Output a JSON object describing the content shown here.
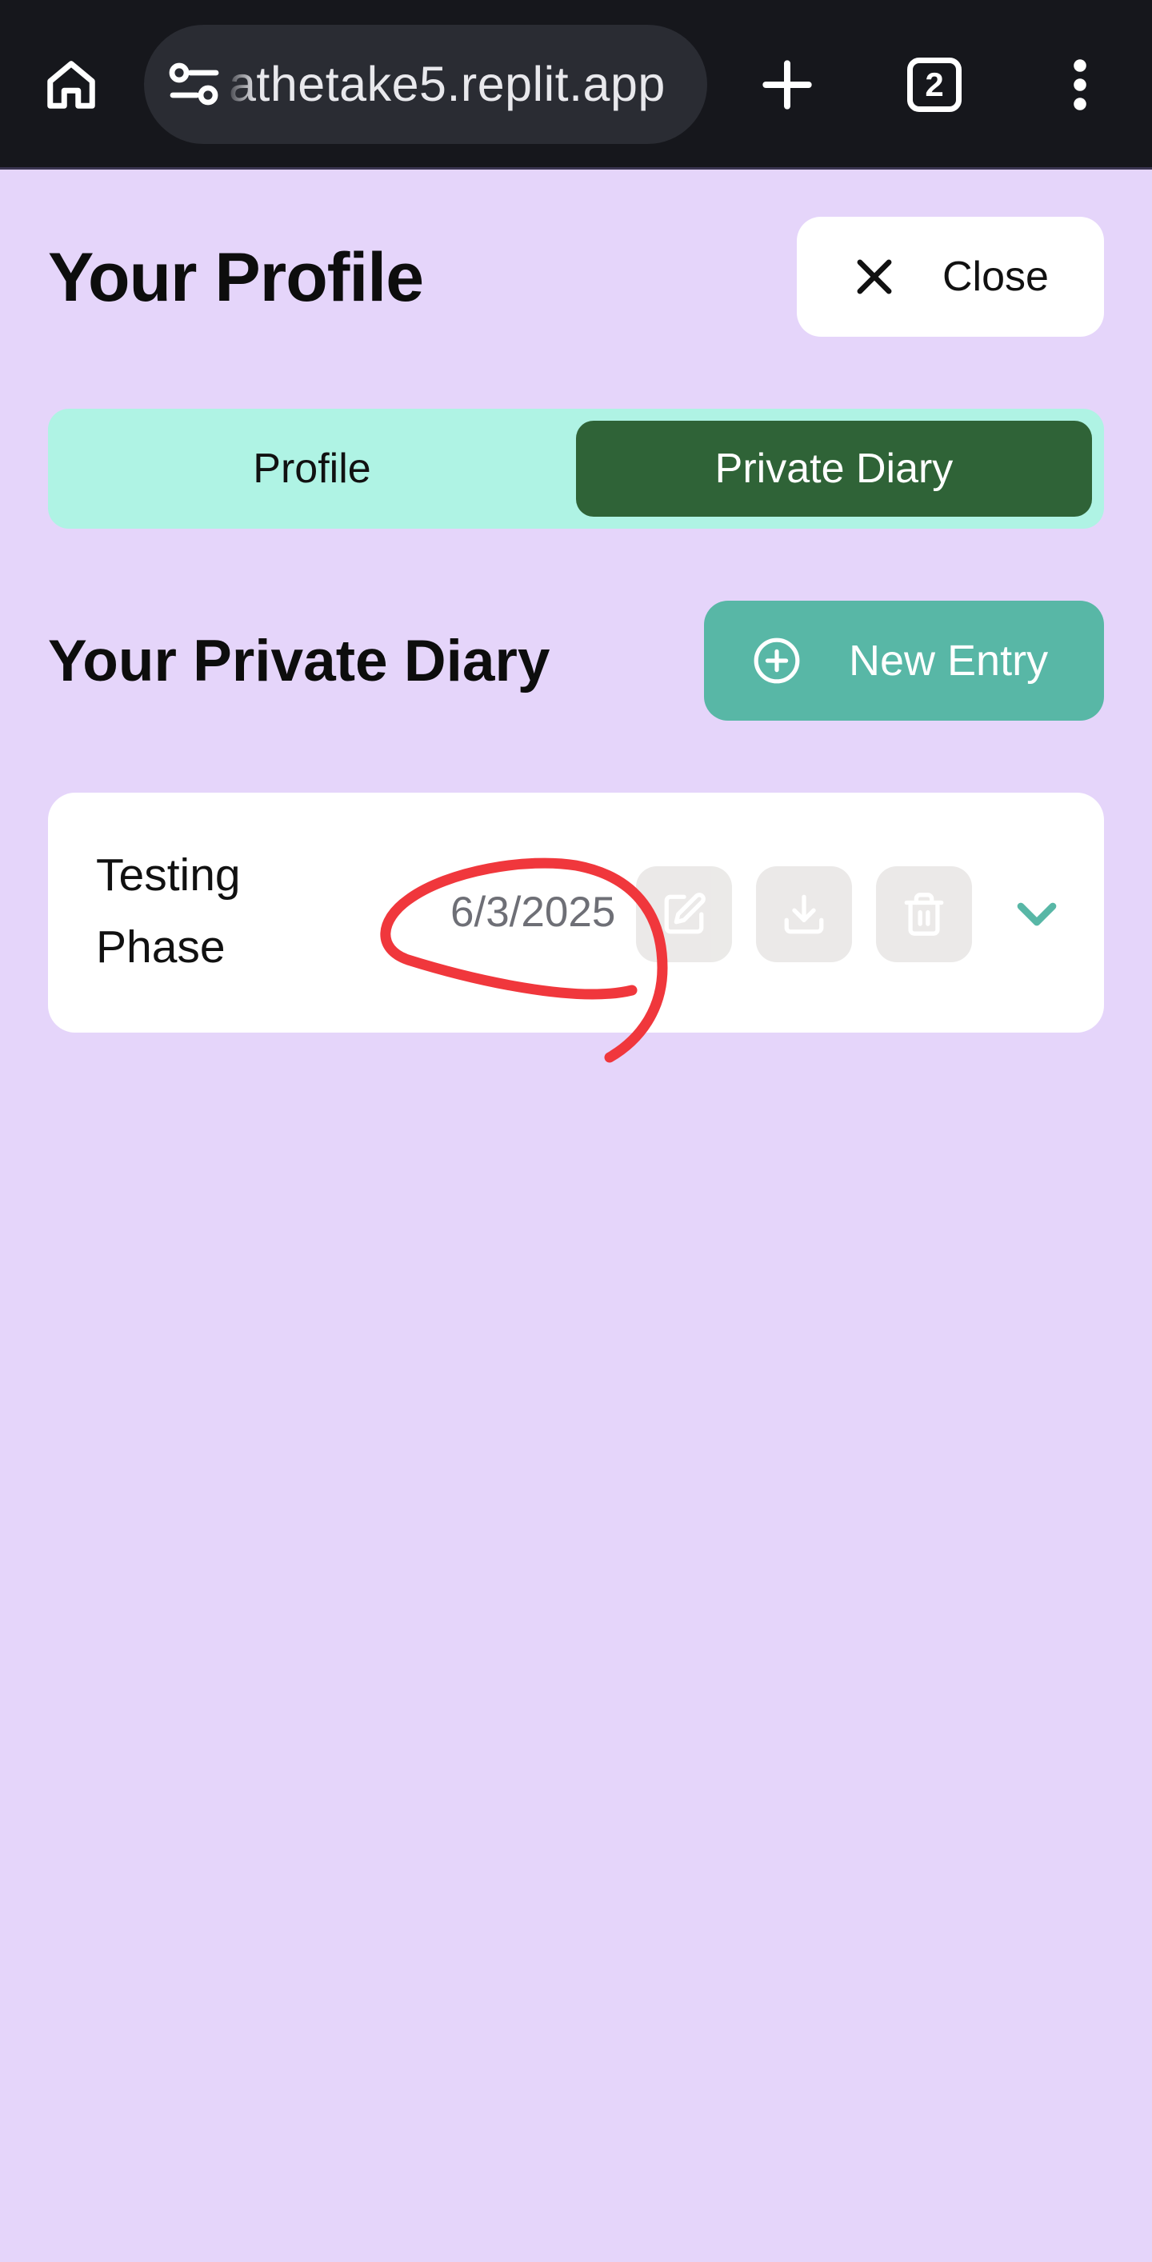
{
  "browser": {
    "url": "athetake5.replit.app",
    "tab_count": "2",
    "icons": {
      "home": "home-icon",
      "site_settings": "tune-icon",
      "new_tab": "plus-icon",
      "tabs": "tab-switcher-icon",
      "menu": "more-vert-icon"
    }
  },
  "header": {
    "title": "Your Profile",
    "close_label": "Close"
  },
  "tabs": [
    {
      "label": "Profile",
      "active": false
    },
    {
      "label": "Private Diary",
      "active": true
    }
  ],
  "diary": {
    "title": "Your Private Diary",
    "new_entry_label": "New Entry",
    "entries": [
      {
        "title": "Testing Phase",
        "date": "6/3/2025",
        "actions": [
          "edit-icon",
          "download-icon",
          "trash-icon"
        ],
        "expand_icon": "chevron-down-icon"
      }
    ]
  },
  "colors": {
    "page_background": "#E5D5FA",
    "browser_bar": "#16171C",
    "tab_track": "#AFF3E4",
    "tab_active": "#2F6337",
    "new_entry_button": "#58B7A6",
    "annotation_stroke": "#F0373C"
  }
}
